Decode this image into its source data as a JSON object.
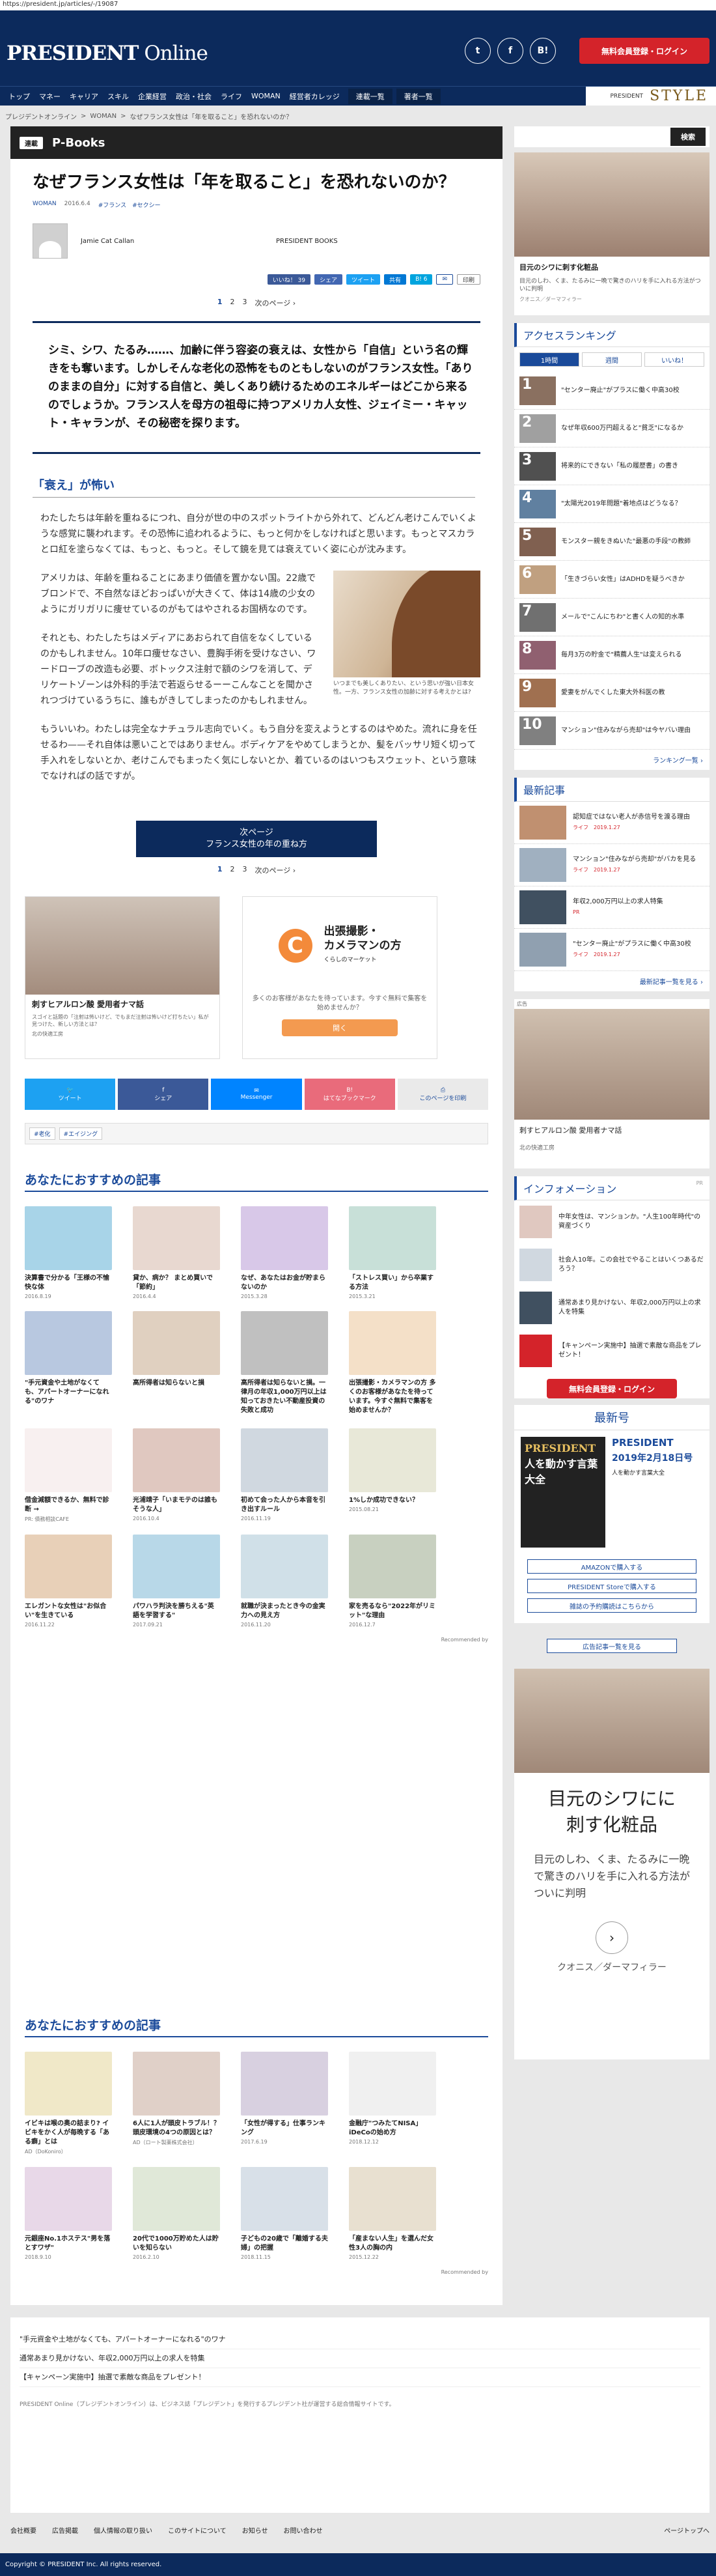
{
  "url": "https://president.jp/articles/-/19087",
  "header": {
    "logo_bold": "PRESIDENT",
    "logo_thin": " Online",
    "social": [
      "t",
      "f",
      "B!"
    ],
    "register": "無料会員登録・ログイン"
  },
  "nav": {
    "items": [
      "トップ",
      "マネー",
      "キャリア",
      "スキル",
      "企業経営",
      "政治・社会",
      "ライフ",
      "WOMAN",
      "経営者カレッジ"
    ],
    "serial": "連載一覧",
    "authors": "著者一覧",
    "style_small": "PRESIDENT",
    "style": "STYLE"
  },
  "breadcrumb": [
    "プレジデントオンライン",
    ">",
    "WOMAN",
    ">",
    "なぜフランス女性は「年を取ること」を恐れないのか？"
  ],
  "section": {
    "tag": "連載",
    "title": "P-Books"
  },
  "article": {
    "title": "なぜフランス女性は「年を取ること」を恐れないのか？",
    "category": "WOMAN",
    "date": "2016.6.4",
    "tags_meta": "#フランス　#セクシー",
    "author": "Jamie Cat Callan",
    "publisher": "PRESIDENT BOOKS",
    "shares": [
      "いいね！ 39",
      "シェア",
      "ツイート",
      "共有",
      "B! 6",
      "印刷"
    ],
    "pager": [
      "1",
      "2",
      "3",
      "次のページ ›"
    ],
    "lead": "シミ、シワ、たるみ……、加齢に伴う容姿の衰えは、女性から「自信」という名の輝きをも奪います。しかしそんな老化の恐怖をものともしないのがフランス女性。「ありのままの自分」に対する自信と、美しくあり続けるためのエネルギーはどこから来るのでしょうか。フランス人を母方の祖母に持つアメリカ人女性、ジェイミー・キャット・キャランが、その秘密を探ります。",
    "h2": "「衰え」が怖い",
    "p1": "わたしたちは年齢を重ねるにつれ、自分が世の中のスポットライトから外れて、どんどん老けこんでいくような感覚に襲われます。その恐怖に追われるように、もっと何かをしなければと思います。もっとマスカラとロ紅を塗らなくては、もっと、もっと。そして鏡を見ては衰えていく姿に心が沈みます。",
    "p2": "アメリカは、年齢を重ねることにあまり価値を置かない国。22歳でブロンドで、不自然なほどおっぱいが大きくて、体は14歳の少女のようにガリガリに痩せているのがもてはやされるお国柄なのです。",
    "p3": "それとも、わたしたちはメディアにあおられて自信をなくしているのかもしれません。10年ロ痩せなさい、豊胸手術を受けなさい、ワードローブの改造も必要、ボトックス注射で額のシワを消して、デリケートゾーンは外科的手法で若返らせるーーこんなことを聞かされつづけているうちに、誰もがきしてしまったのかもしれません。",
    "p4": "もういいわ。わたしは完全なナチュラル志向でいく。もう自分を変えようとするのはやめた。流れに身を任せるわ——それ自体は悪いことではありません。ボディケアをやめてしまうとか、髪をバッサリ短く切って手入れをしないとか、老けこんでもまったく気にしないとか、着ているのはいつもスウェット、という意味でなければの話ですが。",
    "caption": "いつまでも美しくありたい、という思いが強い日本女性。一方、フランス女性の加齢に対する考えかとは?",
    "next_l1": "次ページ",
    "next_l2": "フランス女性の年の重ね方",
    "pager2": [
      "1",
      "2",
      "3",
      "次のページ ›"
    ],
    "tags": [
      "#老化",
      "#エイジング"
    ]
  },
  "ads": {
    "a1_title": "刺すヒアルロン酸 愛用者ナマ話",
    "a1_sub": "スゴイと話題の「注射は怖いけど、でもまだ注射は怖いけど打ちたい」私が見つけた、新しい方法とは？",
    "a1_brand": "北の快適工房",
    "a2_title1": "出張撮影・",
    "a2_title2": "カメラマンの方",
    "a2_sub": "くらしのマーケット",
    "a2_desc": "多くのお客様があなたを待っています。今すぐ無料で集客を始めませんか？",
    "a2_btn": "開く"
  },
  "share_row": [
    "ツイート",
    "シェア",
    "Messenger",
    "はてなブックマーク",
    "このページを印刷"
  ],
  "rec1": {
    "heading": "あなたにおすすめの記事",
    "cards": [
      {
        "t": "決算書で分かる「王様の不愉快な体",
        "d": "2016.8.19",
        "c": "#a8d4e8"
      },
      {
        "t": "貸か、病か？ まとめ買いで「節約」",
        "d": "2016.4.4",
        "c": "#e8d8d0"
      },
      {
        "t": "なぜ、あなたはお金が貯まらないのか",
        "d": "2015.3.28",
        "c": "#d8c8e8"
      },
      {
        "t": "「ストレス買い」から卒業する方法",
        "d": "2015.3.21",
        "c": "#c8e0d8"
      },
      {
        "t": "\"手元資金や土地がなくても、アパートオーナーになれる\"のワナ",
        "d": "",
        "c": "#b8c8e0"
      },
      {
        "t": "高所得者は知らないと損",
        "d": "",
        "c": "#e0d0c0"
      },
      {
        "t": "高所得者は知らないと損。一律月の年収1,000万円以上は知っておきたい不動産投資の失敗と成功",
        "d": "",
        "c": "#c0c0c0"
      },
      {
        "t": "出張撮影・カメラマンの方 多くのお客様があなたを待っています。今すぐ無料で集客を始めませんか？",
        "d": "",
        "c": "#f4e0c8"
      },
      {
        "t": "借金減額できるか、無料で診断 →",
        "d": "PR: 債務相談CAFE",
        "c": "#f8f0f0"
      },
      {
        "t": "光浦靖子「いまモテのは誰もそうな人」",
        "d": "2016.10.4",
        "c": "#e0c8c0"
      },
      {
        "t": "初めて会った人から本音を引き出すルール",
        "d": "2016.11.19",
        "c": "#d0d8e0"
      },
      {
        "t": "1%しか成功できない？",
        "d": "2015.08.21",
        "c": "#e8e8d8"
      },
      {
        "t": "エレガントな女性は\"お似合い\"を生きている",
        "d": "2016.11.22",
        "c": "#e8d0b8"
      },
      {
        "t": "パワハラ判決を勝ちえる\"英語を学習する\"",
        "d": "2017.09.21",
        "c": "#b8d8e8"
      },
      {
        "t": "就職が決まったとき今の金実力への見え方",
        "d": "2016.11.20",
        "c": "#d0e0e8"
      },
      {
        "t": "家を売るなら\"2022年がリミット\"な理由",
        "d": "2016.12.7",
        "c": "#c8d0c0"
      }
    ],
    "recommended": "Recommended by"
  },
  "rec2": {
    "heading": "あなたにおすすめの記事",
    "cards": [
      {
        "t": "イビキは喉の奥の詰まり? イビキをかく人が毎晩する「ある癖」とは",
        "d": "AD（DoKoniro）",
        "c": "#f0e8c8"
      },
      {
        "t": "6人に1人が頭皮トラブル！？頭皮環境の4つの原因とは？",
        "d": "AD（ロート製薬株式会社）",
        "c": "#e0d0c8"
      },
      {
        "t": "「女性が得する」仕事ランキング",
        "d": "2017.6.19",
        "c": "#d8d0e0"
      },
      {
        "t": "金融庁\"つみたてNISA」iDeCoの始め方",
        "d": "2018.12.12",
        "c": "#f0f0f0"
      },
      {
        "t": "元銀座No.1ホステス\"男を落とすワザ\"",
        "d": "2018.9.10",
        "c": "#e8d8e8"
      },
      {
        "t": "20代で1000万貯めた人は貯いを知らない",
        "d": "2016.2.10",
        "c": "#e0e8d8"
      },
      {
        "t": "子どもの20歳で「離婚する夫婦」の把握",
        "d": "2018.11.15",
        "c": "#d8e0e8"
      },
      {
        "t": "「産まない人生」を選んだ女性3人の胸の内",
        "d": "2015.12.22",
        "c": "#e8e0d0"
      }
    ],
    "recommended": "Recommended by"
  },
  "bottom_links": [
    "\"手元資金や土地がなくても、アパートオーナーになれる\"のワナ",
    "通常あまり見かけない、年収2,000万円以上の求人を特集",
    "【キャンペーン実施中】抽選で素敵な商品をプレゼント！"
  ],
  "about": "PRESIDENT Online（プレジデントオンライン）は、ビジネス誌「プレジデント」を発行するプレジデント社が運営する総合情報サイトです。",
  "footer_links": [
    "会社概要",
    "広告掲載",
    "個人情報の取り扱い",
    "このサイトについて",
    "お知らせ",
    "お問い合わせ"
  ],
  "page_top": "ページトップへ",
  "copyright": "Copyright © PRESIDENT Inc. All rights reserved.",
  "sidebar": {
    "search": "検索",
    "ad1": {
      "title": "目元のシワに刺す化粧品",
      "sub": "目元のしわ、くま、たるみに一晩で驚きのハリを手に入れる方法がついに判明",
      "brand": "クオニス／ダーマフィラー"
    },
    "ranking": {
      "heading": "アクセスランキング",
      "tabs": [
        "1時間",
        "週間",
        "いいね！"
      ],
      "items": [
        {
          "n": "1",
          "t": "\"センター廃止\"がプラスに働く中高30校",
          "c": "#8a7060"
        },
        {
          "n": "2",
          "t": "なぜ年収600万円超えると\"貧乏\"になるか",
          "c": "#a0a0a0"
        },
        {
          "n": "3",
          "t": "将来的にできない「私の履歴書」の書き",
          "c": "#505050"
        },
        {
          "n": "4",
          "t": "\"太陽光2019年問題\"着地点はどうなる？",
          "c": "#6080a0"
        },
        {
          "n": "5",
          "t": "モンスター親をきぬいた\"最悪の手段\"の教師",
          "c": "#806050"
        },
        {
          "n": "6",
          "t": "「生きづらい女性」はADHDを疑うべきか",
          "c": "#c0a080"
        },
        {
          "n": "7",
          "t": "メールで\"こんにちわ\"と書く人の知的水準",
          "c": "#707070"
        },
        {
          "n": "8",
          "t": "毎月3万の貯金で\"精薦人生\"は変えられる",
          "c": "#906070"
        },
        {
          "n": "9",
          "t": "愛妻をがんでくした東大外科医の教",
          "c": "#a07050"
        },
        {
          "n": "10",
          "t": "マンション\"住みながら売却\"は今ヤバい理由",
          "c": "#808080"
        }
      ],
      "more": "ランキング一覧 ›"
    },
    "new": {
      "heading": "最新記事",
      "items": [
        {
          "t": "認知症ではない老人が赤信号を渡る理由",
          "d": "ライフ　2019.1.27",
          "c": "#c09070"
        },
        {
          "t": "マンション\"住みながら売却\"がバカを見る",
          "d": "ライフ　2019.1.27",
          "c": "#a0b0c0"
        },
        {
          "t": "年収2,000万円以上の求人特集",
          "d": "PR",
          "c": "#405060"
        },
        {
          "t": "\"センター廃止\"がプラスに働く中高30校",
          "d": "ライフ　2019.1.27",
          "c": "#90a0b0"
        }
      ],
      "more": "最新記事一覧を見る ›"
    },
    "ad2": {
      "label": "広告",
      "title": "刺すヒアルロン酸 愛用者ナマ話",
      "brand": "北の快適工房"
    },
    "info": {
      "heading": "インフォメーション",
      "pr": "PR",
      "items": [
        {
          "t": "中年女性は、マンションか。\"人生100年時代\"の資産づくり",
          "c": "#e0c8c0"
        },
        {
          "t": "社会人10年。この会社でやることはいくつあるだろう？",
          "c": "#d0d8e0"
        },
        {
          "t": "通常あまり見かけない、年収2,000万円以上の求人を特集",
          "c": "#405060"
        },
        {
          "t": "【キャンペーン実施中】抽選で素敵な商品をプレゼント！",
          "c": "#d4232a"
        }
      ],
      "register": "無料会員登録・ログイン"
    },
    "magazine": {
      "heading": "最新号",
      "name": "PRESIDENT",
      "date": "2019年2月18日号",
      "cover_title": "人を動かす言葉大全",
      "desc": "人を動かす言葉大全",
      "btn1": "AMAZONで購入する",
      "btn2": "PRESIDENT Storeで購入する",
      "btn3": "雑誌の予約購読はこちらから"
    },
    "adlist": "広告記事一覧を見る",
    "ad3": {
      "title1": "目元のシワにに",
      "title2": "刺す化粧品",
      "sub": "目元のしわ、くま、たるみに一晩で驚きのハリを手に入れる方法がついに判明",
      "brand": "クオニス／ダーマフィラー"
    }
  }
}
